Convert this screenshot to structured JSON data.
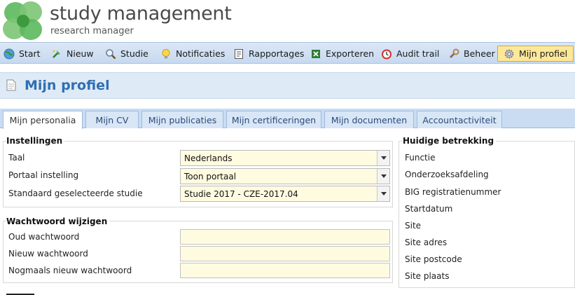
{
  "app": {
    "title": "study management",
    "subtitle": "research manager"
  },
  "toolbar": {
    "items": [
      {
        "label": "Start",
        "icon": "globe-icon"
      },
      {
        "label": "Nieuw",
        "icon": "new-icon"
      },
      {
        "label": "Studie",
        "icon": "search-icon"
      },
      {
        "label": "Notificaties",
        "icon": "lightbulb-icon"
      },
      {
        "label": "Rapportages",
        "icon": "report-icon"
      },
      {
        "label": "Exporteren",
        "icon": "excel-icon"
      },
      {
        "label": "Audit trail",
        "icon": "clock-icon"
      },
      {
        "label": "Beheer",
        "icon": "wrench-icon"
      },
      {
        "label": "Mijn profiel",
        "icon": "gear-icon",
        "active": true
      }
    ]
  },
  "page": {
    "title": "Mijn profiel"
  },
  "tabs": [
    {
      "label": "Mijn personalia",
      "active": true
    },
    {
      "label": "Mijn CV"
    },
    {
      "label": "Mijn publicaties"
    },
    {
      "label": "Mijn certificeringen"
    },
    {
      "label": "Mijn documenten"
    },
    {
      "label": "Accountactiviteit"
    }
  ],
  "settings": {
    "legend": "Instellingen",
    "taal_label": "Taal",
    "taal_value": "Nederlands",
    "portaal_label": "Portaal instelling",
    "portaal_value": "Toon portaal",
    "studie_label": "Standaard geselecteerde studie",
    "studie_value": "Studie 2017 - CZE-2017.04"
  },
  "password": {
    "legend": "Wachtwoord wijzigen",
    "old_label": "Oud wachtwoord",
    "new_label": "Nieuw wachtwoord",
    "repeat_label": "Nogmaals nieuw wachtwoord"
  },
  "employment": {
    "legend": "Huidige betrekking",
    "fields": [
      "Functie",
      "Onderzoeksafdeling",
      "BIG registratienummer",
      "Startdatum",
      "Site",
      "Site adres",
      "Site postcode",
      "Site plaats"
    ]
  },
  "colors": {
    "accent": "#2f6fb3",
    "toolbar_bg": "#c7d9ef",
    "input_bg": "#fffbe0",
    "active_tool": "#fde89a"
  }
}
